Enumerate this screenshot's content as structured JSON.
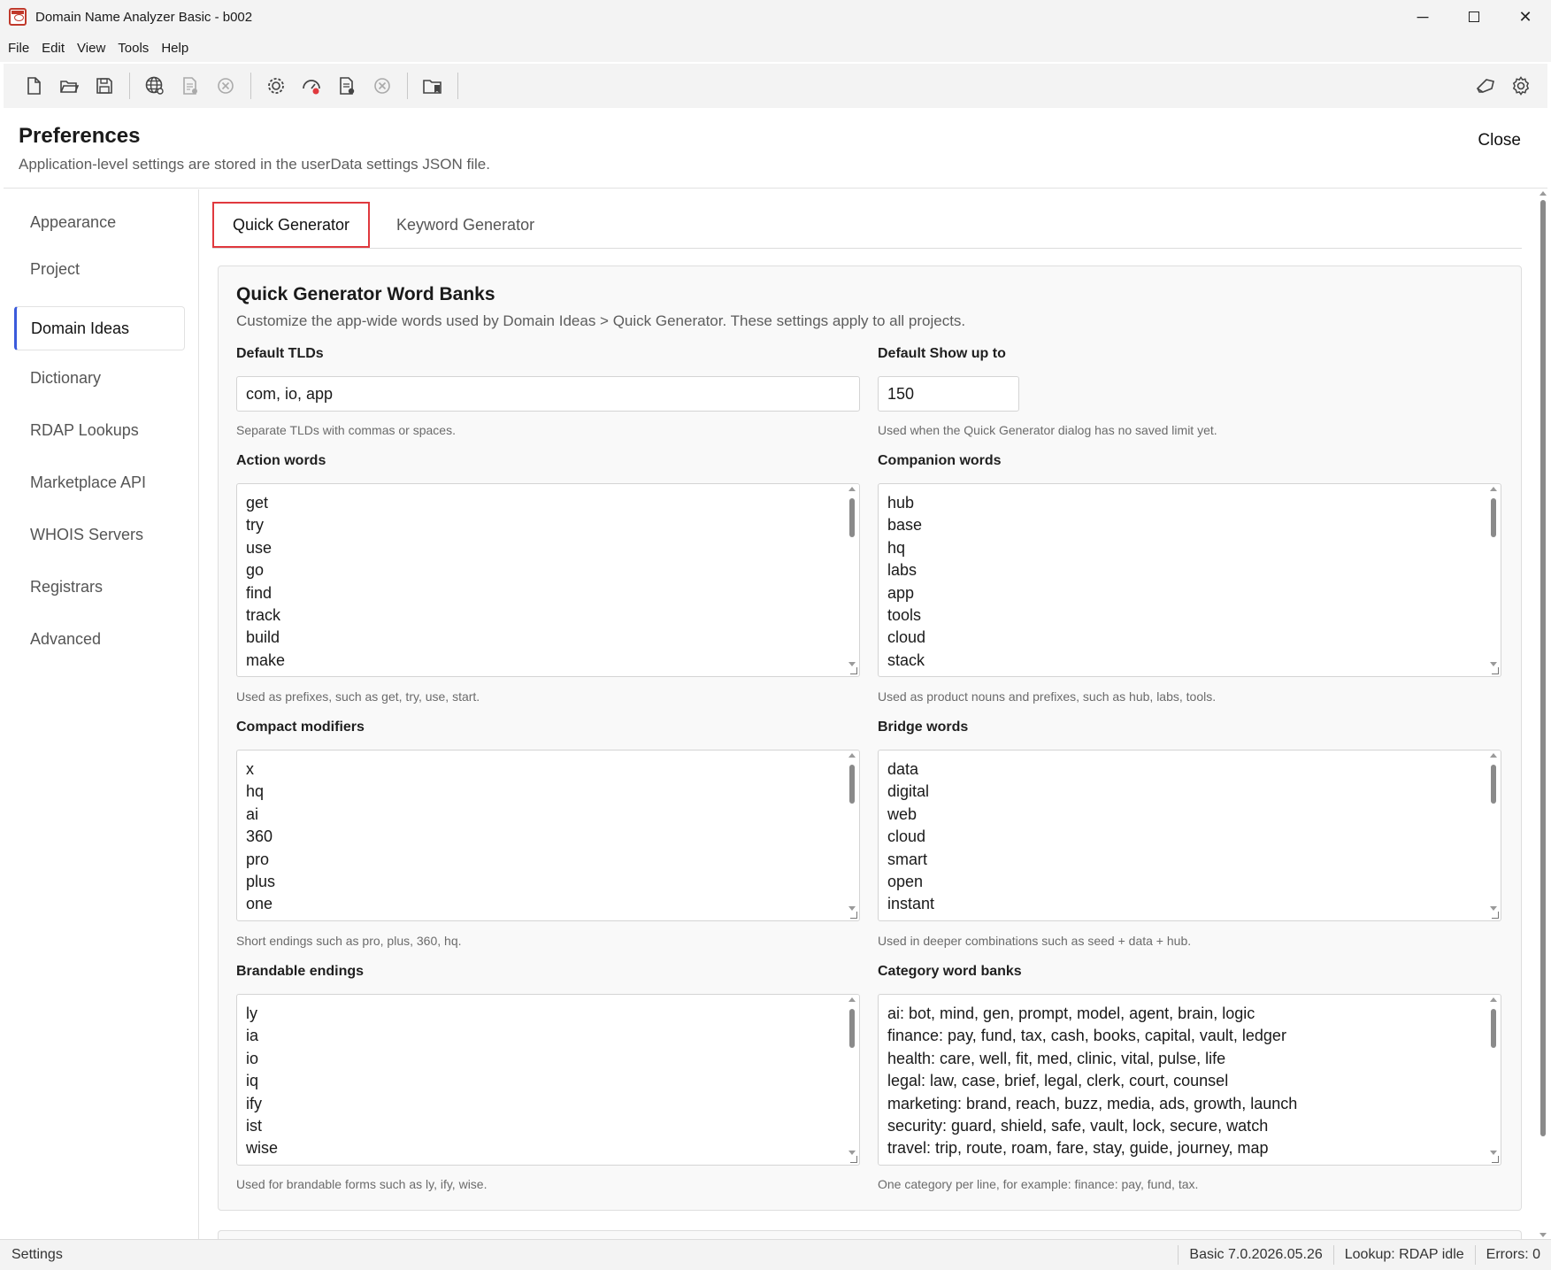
{
  "window": {
    "title": "Domain Name Analyzer Basic - b002",
    "minimize": "─",
    "close": "✕"
  },
  "menu": [
    "File",
    "Edit",
    "View",
    "Tools",
    "Help"
  ],
  "toolbar": {
    "icons": [
      "new-file-icon",
      "open-folder-icon",
      "save-icon",
      "globe-icon",
      "document-icon",
      "cancel-icon",
      "gear-check-icon",
      "speedometer-icon",
      "document-check-icon",
      "cancel-icon",
      "folder-bookmark-icon"
    ],
    "right_icons": [
      "label-icon",
      "settings-icon"
    ]
  },
  "preferences": {
    "title": "Preferences",
    "subtitle": "Application-level settings are stored in the userData settings JSON file.",
    "close_label": "Close"
  },
  "sidebar": {
    "items": [
      {
        "label": "Appearance"
      },
      {
        "label": "Project"
      },
      {
        "label": "Domain Ideas"
      },
      {
        "label": "Dictionary"
      },
      {
        "label": "RDAP Lookups"
      },
      {
        "label": "Marketplace API"
      },
      {
        "label": "WHOIS Servers"
      },
      {
        "label": "Registrars"
      },
      {
        "label": "Advanced"
      }
    ],
    "active": "Domain Ideas"
  },
  "tabs": [
    {
      "label": "Quick Generator"
    },
    {
      "label": "Keyword Generator"
    }
  ],
  "panel": {
    "title": "Quick Generator Word Banks",
    "description": "Customize the app-wide words used by Domain Ideas > Quick Generator. These settings apply to all projects.",
    "default_tlds": {
      "label": "Default TLDs",
      "value": "com, io, app",
      "help": "Separate TLDs with commas or spaces."
    },
    "default_show": {
      "label": "Default Show up to",
      "value": "150",
      "help": "Used when the Quick Generator dialog has no saved limit yet."
    },
    "action_words": {
      "label": "Action words",
      "lines": [
        "get",
        "try",
        "use",
        "go",
        "find",
        "track",
        "build",
        "make"
      ],
      "help": "Used as prefixes, such as get, try, use, start."
    },
    "companion_words": {
      "label": "Companion words",
      "lines": [
        "hub",
        "base",
        "hq",
        "labs",
        "app",
        "tools",
        "cloud",
        "stack"
      ],
      "help": "Used as product nouns and prefixes, such as hub, labs, tools."
    },
    "compact_modifiers": {
      "label": "Compact modifiers",
      "lines": [
        "x",
        "hq",
        "ai",
        "360",
        "pro",
        "plus",
        "one"
      ],
      "help": "Short endings such as pro, plus, 360, hq."
    },
    "bridge_words": {
      "label": "Bridge words",
      "lines": [
        "data",
        "digital",
        "web",
        "cloud",
        "smart",
        "open",
        "instant"
      ],
      "help": "Used in deeper combinations such as seed + data + hub."
    },
    "brandable_endings": {
      "label": "Brandable endings",
      "lines": [
        "ly",
        "ia",
        "io",
        "iq",
        "ify",
        "ist",
        "wise"
      ],
      "help": "Used for brandable forms such as ly, ify, wise."
    },
    "category_banks": {
      "label": "Category word banks",
      "lines": [
        "ai: bot, mind, gen, prompt, model, agent, brain, logic",
        "finance: pay, fund, tax, cash, books, capital, vault, ledger",
        "health: care, well, fit, med, clinic, vital, pulse, life",
        "legal: law, case, brief, legal, clerk, court, counsel",
        "marketing: brand, reach, buzz, media, ads, growth, launch",
        "security: guard, shield, safe, vault, lock, secure, watch",
        "travel: trip, route, roam, fare, stay, guide, journey, map"
      ],
      "help": "One category per line, for example: finance: pay, fund, tax."
    }
  },
  "status": {
    "left": "Settings",
    "version": "Basic 7.0.2026.05.26",
    "lookup": "Lookup: RDAP idle",
    "errors": "Errors: 0"
  },
  "colors": {
    "accent": "#3b5bdb",
    "tab_highlight": "#e0393e",
    "chrome": "#f3f3f3"
  }
}
